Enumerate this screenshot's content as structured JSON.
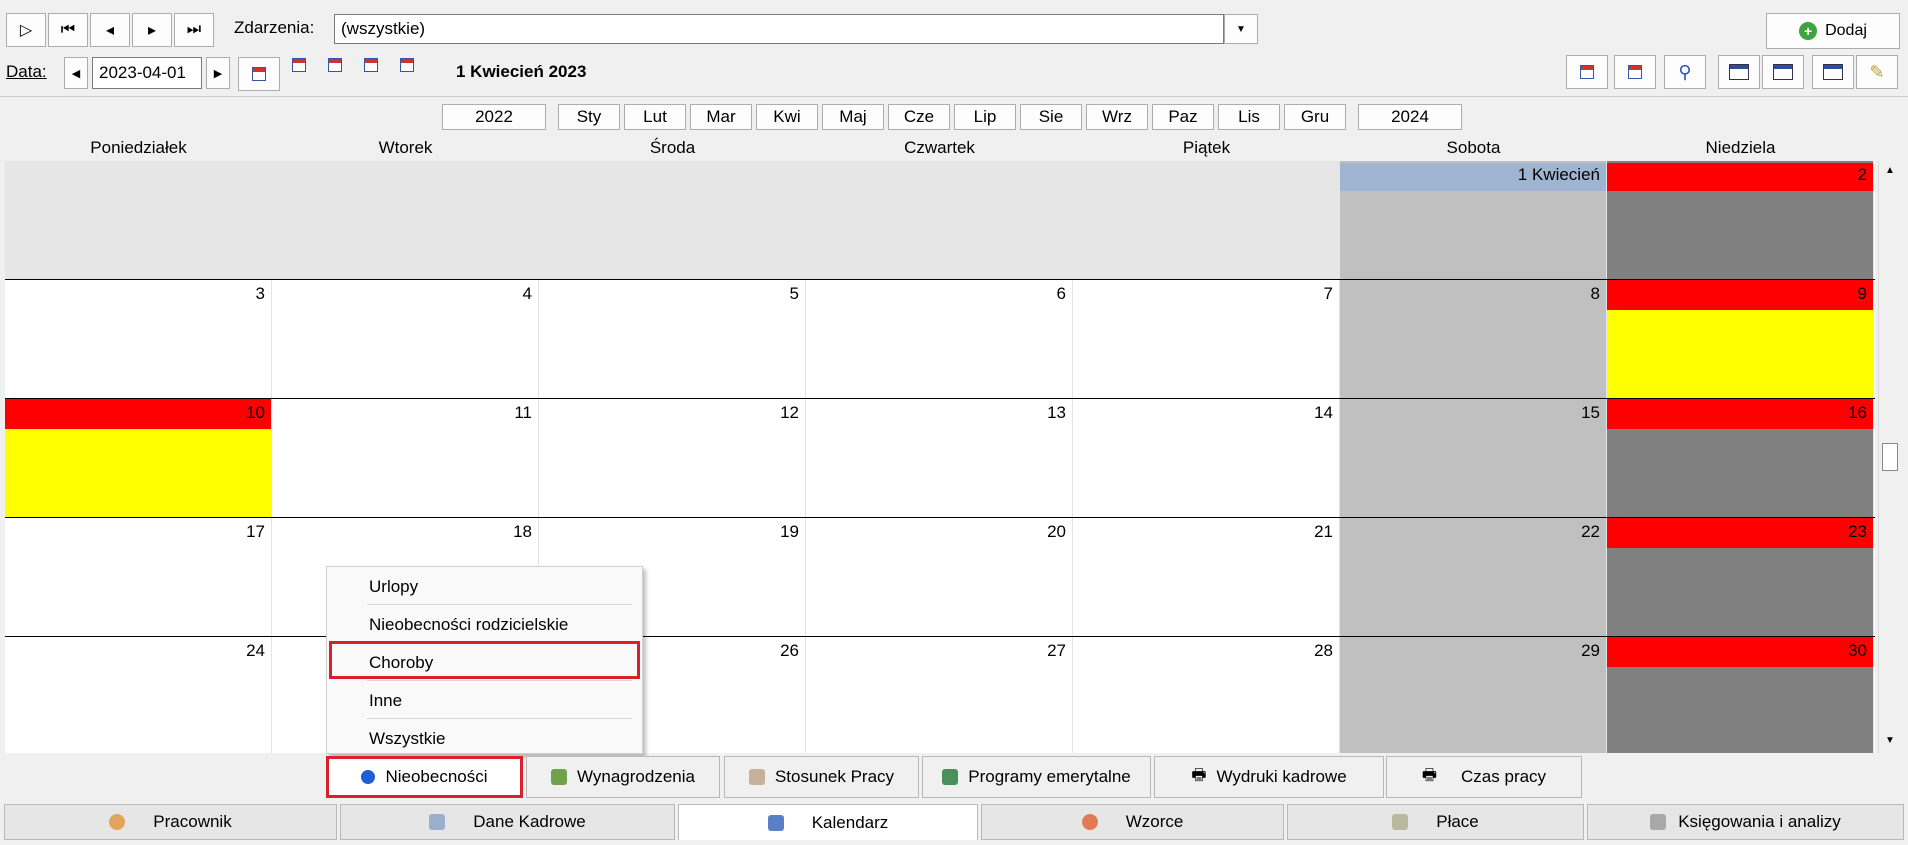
{
  "toolbar": {
    "nav_buttons": [
      "▷",
      "⏮",
      "◂",
      "▸",
      "⏭"
    ],
    "events_label": "Zdarzenia:",
    "events_value": "(wszystkie)",
    "add_button_label": "Dodaj"
  },
  "date_bar": {
    "date_label": "Data:",
    "date_value": "2023-04-01",
    "current_date_title": "1 Kwiecień 2023"
  },
  "month_nav": {
    "prev_year": "2022",
    "months": [
      "Sty",
      "Lut",
      "Mar",
      "Kwi",
      "Maj",
      "Cze",
      "Lip",
      "Sie",
      "Wrz",
      "Paz",
      "Lis",
      "Gru"
    ],
    "next_year": "2024"
  },
  "weekdays": [
    "Poniedziałek",
    "Wtorek",
    "Środa",
    "Czwartek",
    "Piątek",
    "Sobota",
    "Niedziela"
  ],
  "calendar": {
    "week1": {
      "sat_label": "1 Kwiecień",
      "sun_label": "2"
    },
    "week2": [
      "3",
      "4",
      "5",
      "6",
      "7",
      "8",
      "9"
    ],
    "week3": [
      "10",
      "11",
      "12",
      "13",
      "14",
      "15",
      "16"
    ],
    "week4": [
      "17",
      "18",
      "19",
      "20",
      "21",
      "22",
      "23"
    ],
    "week5": [
      "24",
      "",
      "26",
      "27",
      "28",
      "29",
      "30"
    ]
  },
  "colors": {
    "sunday_header": "#ff0000",
    "holiday_fill": "#ffff00",
    "saturday_fill": "#c0c0c0",
    "sunday_fill": "#808080",
    "first_day_header": "#9fb4d0",
    "highlight_border": "#d9202b"
  },
  "context_menu": {
    "items": [
      "Urlopy",
      "Nieobecności rodzicielskie",
      "Choroby",
      "Inne",
      "Wszystkie"
    ],
    "highlighted": "Choroby"
  },
  "sub_tabs": [
    "Nieobecności",
    "Wynagrodzenia",
    "Stosunek Pracy",
    "Programy emerytalne",
    "Wydruki kadrowe",
    "Czas pracy"
  ],
  "main_tabs": [
    "Pracownik",
    "Dane Kadrowe",
    "Kalendarz",
    "Wzorce",
    "Płace",
    "Księgowania i analizy"
  ]
}
